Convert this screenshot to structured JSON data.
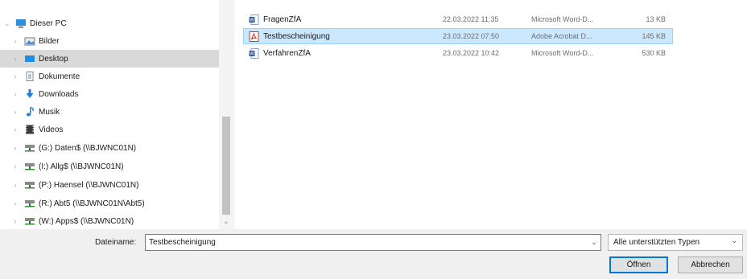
{
  "nav": {
    "items": [
      {
        "label": "Dieser PC",
        "icon": "this-pc-icon"
      },
      {
        "label": "Bilder",
        "icon": "pictures-icon"
      },
      {
        "label": "Desktop",
        "icon": "desktop-icon"
      },
      {
        "label": "Dokumente",
        "icon": "documents-icon"
      },
      {
        "label": "Downloads",
        "icon": "downloads-icon"
      },
      {
        "label": "Musik",
        "icon": "music-icon"
      },
      {
        "label": "Videos",
        "icon": "videos-icon"
      },
      {
        "label": "(G:) Daten$ (\\\\BJWNC01N)",
        "icon": "network-drive-icon"
      },
      {
        "label": "(I:) Allg$ (\\\\BJWNC01N)",
        "icon": "network-drive-icon"
      },
      {
        "label": "(P:) Haensel (\\\\BJWNC01N)",
        "icon": "network-drive-icon"
      },
      {
        "label": "(R:) Abt5 (\\\\BJWNC01N\\Abt5)",
        "icon": "network-drive-icon"
      },
      {
        "label": "(W:) Apps$ (\\\\BJWNC01N)",
        "icon": "network-drive-icon"
      }
    ]
  },
  "files": [
    {
      "name": "FragenZfA",
      "date": "22.03.2022 11:35",
      "type": "Microsoft Word-D...",
      "size": "13 KB",
      "icon": "word-document-icon"
    },
    {
      "name": "Testbescheinigung",
      "date": "23.03.2022 07:50",
      "type": "Adobe Acrobat D...",
      "size": "145 KB",
      "icon": "pdf-document-icon"
    },
    {
      "name": "VerfahrenZfA",
      "date": "23.03.2022 10:42",
      "type": "Microsoft Word-D...",
      "size": "530 KB",
      "icon": "word-document-icon"
    }
  ],
  "footer": {
    "filename_label": "Dateiname:",
    "filename_value": "Testbescheinigung",
    "filetype_value": "Alle unterstützten Typen",
    "open_label": "Öffnen",
    "cancel_label": "Abbrechen"
  },
  "colors": {
    "selection": "#cce8ff",
    "nav_selection": "#d9d9d9",
    "accent": "#0078d7"
  }
}
